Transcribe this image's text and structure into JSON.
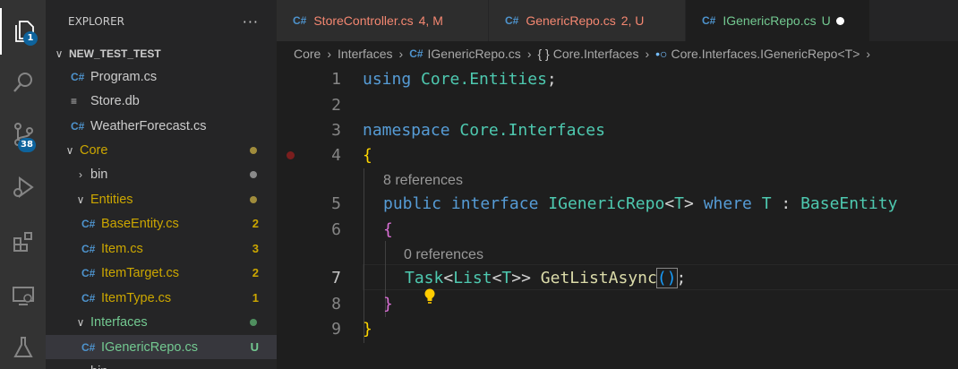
{
  "activity_bar": {
    "explorer_badge": "1",
    "scm_badge": "38"
  },
  "sidebar": {
    "title": "EXPLORER",
    "more": "···",
    "workspace": "NEW_TEST_TEST",
    "items": [
      {
        "label": "Program.cs",
        "icon": "csharp-file-icon",
        "decoration": ""
      },
      {
        "label": "Store.db",
        "icon": "database-file-icon",
        "decoration": ""
      },
      {
        "label": "WeatherForecast.cs",
        "icon": "csharp-file-icon",
        "decoration": ""
      },
      {
        "label": "Core",
        "icon": "folder-open",
        "decoration": "dot"
      },
      {
        "label": "bin",
        "icon": "folder-closed",
        "decoration": "dot"
      },
      {
        "label": "Entities",
        "icon": "folder-open",
        "decoration": "dot"
      },
      {
        "label": "BaseEntity.cs",
        "icon": "csharp-file-icon",
        "decoration": "2"
      },
      {
        "label": "Item.cs",
        "icon": "csharp-file-icon",
        "decoration": "3"
      },
      {
        "label": "ItemTarget.cs",
        "icon": "csharp-file-icon",
        "decoration": "2"
      },
      {
        "label": "ItemType.cs",
        "icon": "csharp-file-icon",
        "decoration": "1"
      },
      {
        "label": "Interfaces",
        "icon": "folder-open",
        "decoration": "dot"
      },
      {
        "label": "IGenericRepo.cs",
        "icon": "csharp-file-icon",
        "decoration": "U"
      },
      {
        "label": "bin",
        "icon": "folder-closed",
        "decoration": ""
      }
    ]
  },
  "tabs": [
    {
      "title": "StoreController.cs",
      "status": "4, M",
      "active": false
    },
    {
      "title": "GenericRepo.cs",
      "status": "2, U",
      "active": false
    },
    {
      "title": "IGenericRepo.cs",
      "status": "U",
      "active": true
    }
  ],
  "breadcrumb": {
    "parts": [
      "Core",
      "Interfaces",
      "IGenericRepo.cs",
      "Core.Interfaces",
      "Core.Interfaces.IGenericRepo<T>"
    ],
    "ns_glyph": "{ }",
    "iface_glyph": "•○"
  },
  "editor": {
    "lines": [
      {
        "num": "1"
      },
      {
        "num": "2"
      },
      {
        "num": "3"
      },
      {
        "num": "4"
      },
      {
        "num": "5"
      },
      {
        "num": "6"
      },
      {
        "num": "7"
      },
      {
        "num": "8"
      },
      {
        "num": "9"
      }
    ],
    "code": {
      "l1_kw": "using",
      "l1_ns": "Core.Entities",
      "l1_end": ";",
      "l3_kw": "namespace",
      "l3_ns": "Core.Interfaces",
      "l4_brace": "{",
      "l5_kw1": "public",
      "l5_kw2": "interface",
      "l5_name": "IGenericRepo",
      "l5_lt": "<",
      "l5_t": "T",
      "l5_gt": ">",
      "l5_where": "where",
      "l5_t2": "T",
      "l5_colon": " : ",
      "l5_base": "BaseEntity",
      "l6_brace": "{",
      "l7_task": "Task",
      "l7_lt1": "<",
      "l7_list": "List",
      "l7_lt2": "<",
      "l7_t": "T",
      "l7_gt": ">>",
      "l7_fn": "GetListAsync",
      "l7_parens": "()",
      "l7_end": ";",
      "l8_brace": "}",
      "l9_brace": "}"
    },
    "codelens": [
      "8 references",
      "0 references"
    ]
  }
}
